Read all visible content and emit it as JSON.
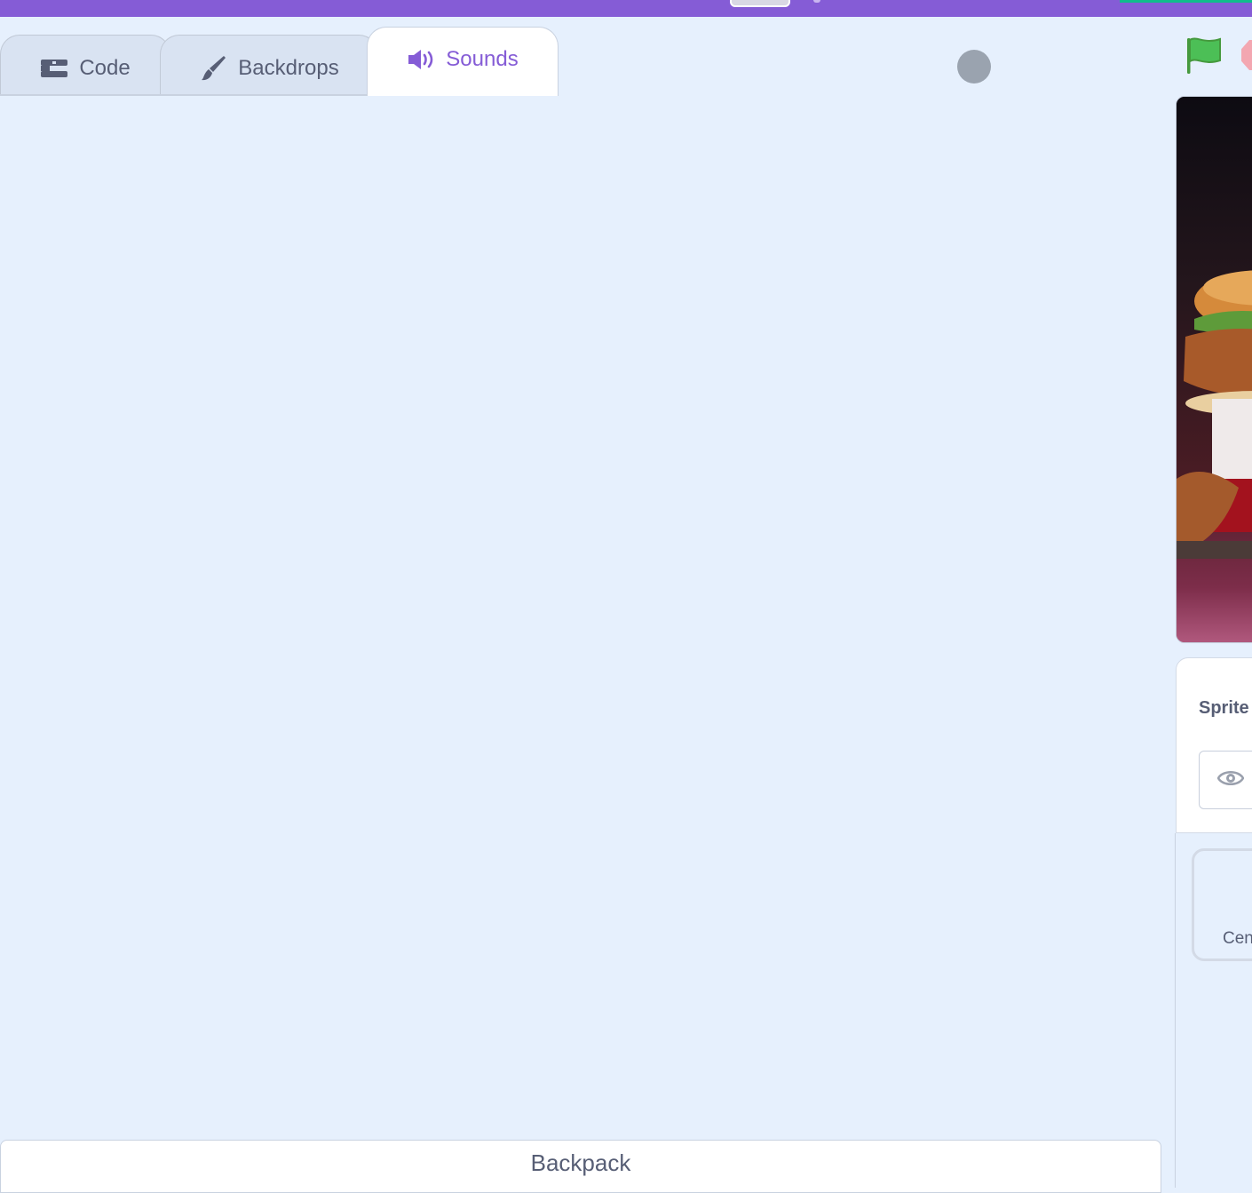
{
  "tabs": {
    "code": {
      "label": "Code",
      "icon": "code-blocks-icon"
    },
    "backdrops": {
      "label": "Backdrops",
      "icon": "paintbrush-icon"
    },
    "sounds": {
      "label": "Sounds",
      "icon": "speaker-icon",
      "active": true
    }
  },
  "controls": {
    "green_flag": "green-flag-icon",
    "stop": "stop-icon"
  },
  "sprite_panel": {
    "label": "Sprite"
  },
  "backdrop_card": {
    "label": "Cen"
  },
  "backpack": {
    "label": "Backpack"
  },
  "colors": {
    "menu_bar": "#855cd6",
    "accent": "#855cd6",
    "background": "#e6f0fd",
    "text": "#575e75",
    "green": "#0fbd8c"
  }
}
